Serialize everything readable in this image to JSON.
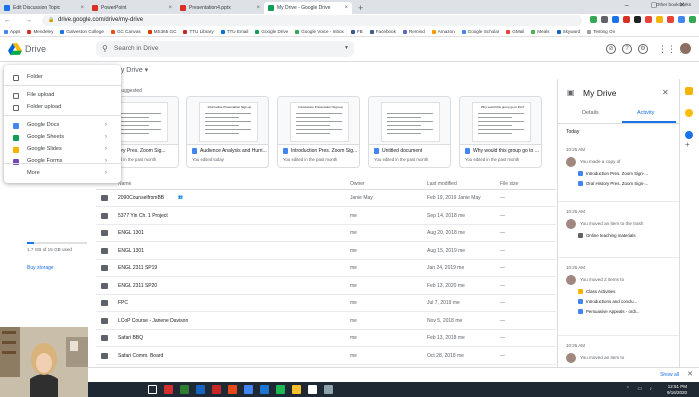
{
  "browser": {
    "tabs": [
      {
        "label": "Edit Discussion Topic",
        "color": "#1a73e8",
        "active": false
      },
      {
        "label": "PowerPoint",
        "color": "#d93025",
        "active": false
      },
      {
        "label": "Presentation4.pptx",
        "color": "#d93025",
        "active": false
      },
      {
        "label": "My Drive - Google Drive",
        "color": "#0f9d58",
        "active": true
      }
    ],
    "new_tab_icon": "plus-icon",
    "url": "drive.google.com/drive/my-drive",
    "extensions": [
      "#34a853",
      "#5f6368",
      "#1a73e8",
      "#d93025",
      "#202124",
      "#ea4335",
      "#f4b400",
      "#ea4335",
      "#4285f4",
      "#34a853"
    ],
    "bookmarks": [
      {
        "label": "Apps",
        "color": "#4285f4"
      },
      {
        "label": "Mendeley",
        "color": "#d93025"
      },
      {
        "label": "Galveston College",
        "color": "#1a73e8"
      },
      {
        "label": "GC Canvas",
        "color": "#e94e1b"
      },
      {
        "label": "MS365 GC",
        "color": "#d83b01"
      },
      {
        "label": "TTU Library",
        "color": "#c62828"
      },
      {
        "label": "TTU Email",
        "color": "#0078d4"
      },
      {
        "label": "Google Drive",
        "color": "#0f9d58"
      },
      {
        "label": "Google Voice - Inbox",
        "color": "#34a853"
      },
      {
        "label": "FB",
        "color": "#3b5998"
      },
      {
        "label": "Facebook",
        "color": "#3b5998"
      },
      {
        "label": "Remind",
        "color": "#5c6bc0"
      },
      {
        "label": "Amazon",
        "color": "#ff9900"
      },
      {
        "label": "Google Scholar",
        "color": "#4285f4"
      },
      {
        "label": "GMail",
        "color": "#ea4335"
      },
      {
        "label": "Meals",
        "color": "#4caf50"
      },
      {
        "label": "Skyward",
        "color": "#1565c0"
      },
      {
        "label": "Testing On",
        "color": "#9e9e9e"
      }
    ],
    "other_bookmarks": "Other bookmarks"
  },
  "drive": {
    "app_name": "Drive",
    "search_placeholder": "Search in Drive",
    "breadcrumb": "My Drive",
    "quick_access_label": "Suggested",
    "storage_text": "1.7 GB of 15 GB used",
    "storage_fraction": 0.113,
    "buy_storage": "Buy storage",
    "new_menu": {
      "items": [
        {
          "label": "Folder",
          "icon": "folder-icon",
          "color": "#5f6368",
          "arrow": false
        },
        {
          "label": "File upload",
          "icon": "file-upload-icon",
          "color": "#5f6368",
          "arrow": false
        },
        {
          "label": "Folder upload",
          "icon": "folder-upload-icon",
          "color": "#5f6368",
          "arrow": false
        },
        {
          "label": "Google Docs",
          "icon": "google-docs-icon",
          "color": "#4285f4",
          "arrow": true
        },
        {
          "label": "Google Sheets",
          "icon": "google-sheets-icon",
          "color": "#0f9d58",
          "arrow": true
        },
        {
          "label": "Google Slides",
          "icon": "google-slides-icon",
          "color": "#f4b400",
          "arrow": true
        },
        {
          "label": "Google Forms",
          "icon": "google-forms-icon",
          "color": "#7248b9",
          "arrow": true
        },
        {
          "label": "More",
          "icon": "",
          "color": "",
          "arrow": true
        }
      ]
    },
    "cards": [
      {
        "title": "History Pres. Zoom Sig...",
        "subtitle": "You edited in the past month",
        "color": "#4285f4",
        "doc_title": ""
      },
      {
        "title": "Audience Analysis and Hurri...",
        "subtitle": "You edited today",
        "color": "#4285f4",
        "doc_title": "Informative Presentation Sign-up"
      },
      {
        "title": "Introduction Pres. Zoom Sig...",
        "subtitle": "You edited in the past month",
        "color": "#4285f4",
        "doc_title": "Introduction Presentation Sign-up"
      },
      {
        "title": "Untitled document",
        "subtitle": "You edited in the past month",
        "color": "#4285f4",
        "doc_title": ""
      },
      {
        "title": "Why would this group go to ...",
        "subtitle": "You edited in the past month",
        "color": "#4285f4",
        "doc_title": "Why would this group go to this?"
      }
    ],
    "columns": {
      "name": "Name",
      "owner": "Owner",
      "modified": "Last modified",
      "size": "File size"
    },
    "files": [
      {
        "name": "2090CounselfromBB",
        "shared": true,
        "owner": "Janie May",
        "modified": "Feb 19, 2019 Janie May",
        "size": "—"
      },
      {
        "name": "5377 Yin Ch. 1 Project",
        "shared": false,
        "owner": "me",
        "modified": "Sep 14, 2018 me",
        "size": "—"
      },
      {
        "name": "ENGL 1301",
        "shared": false,
        "owner": "me",
        "modified": "Aug 20, 2018 me",
        "size": "—"
      },
      {
        "name": "ENGL 1301",
        "shared": false,
        "owner": "me",
        "modified": "Aug 15, 2019 me",
        "size": "—"
      },
      {
        "name": "ENGL 2311 SP19",
        "shared": false,
        "owner": "me",
        "modified": "Jan 24, 2019 me",
        "size": "—"
      },
      {
        "name": "ENGL 2311 SP20",
        "shared": false,
        "owner": "me",
        "modified": "Feb 13, 2020 me",
        "size": "—"
      },
      {
        "name": "FPC",
        "shared": false,
        "owner": "me",
        "modified": "Jul 7, 2019 me",
        "size": "—"
      },
      {
        "name": "LCoP Course - Janene Davison",
        "shared": false,
        "owner": "me",
        "modified": "Nov 5, 2018 me",
        "size": "—"
      },
      {
        "name": "Safari BBQ",
        "shared": false,
        "owner": "me",
        "modified": "Feb 13, 2018 me",
        "size": "—"
      },
      {
        "name": "Safari Comm. Board",
        "shared": false,
        "owner": "me",
        "modified": "Oct 28, 2018 me",
        "size": "—"
      }
    ]
  },
  "details": {
    "title": "My Drive",
    "tabs": [
      "Details",
      "Activity"
    ],
    "active_tab": "Activity",
    "section": "Today",
    "activities": [
      {
        "time": "10:25 AM",
        "text": "You made a copy of",
        "items": [
          "Introduction Pres. Zoom Sign-...",
          "Oral History Pres. Zoom Sign-..."
        ],
        "item_color": "#4285f4"
      },
      {
        "time": "10:25 AM",
        "text": "You moved an item to the trash",
        "items": [
          "Online teaching materials"
        ],
        "item_color": "#5f6368"
      },
      {
        "time": "10:25 AM",
        "text": "You moved 2 items to",
        "items": [
          "Class Activities",
          "Introductions and conclu...",
          "Persuasive Appeals - ordi..."
        ],
        "item_color": "#f4b400"
      },
      {
        "time": "10:25 AM",
        "text": "You moved an item to",
        "items": [],
        "item_color": "#5f6368"
      }
    ]
  },
  "download_bar": {
    "show_all": "Show all"
  },
  "taskbar": {
    "apps": [
      "#ffffff",
      "#d32f2f",
      "#2e7d32",
      "#1565c0",
      "#c62828",
      "#e64a19",
      "#4285f4",
      "#1976d2",
      "#1db954",
      "#fbc02d",
      "#ffffff",
      "#90a4ae"
    ],
    "time": "12:51 PM",
    "date": "9/16/2020"
  }
}
